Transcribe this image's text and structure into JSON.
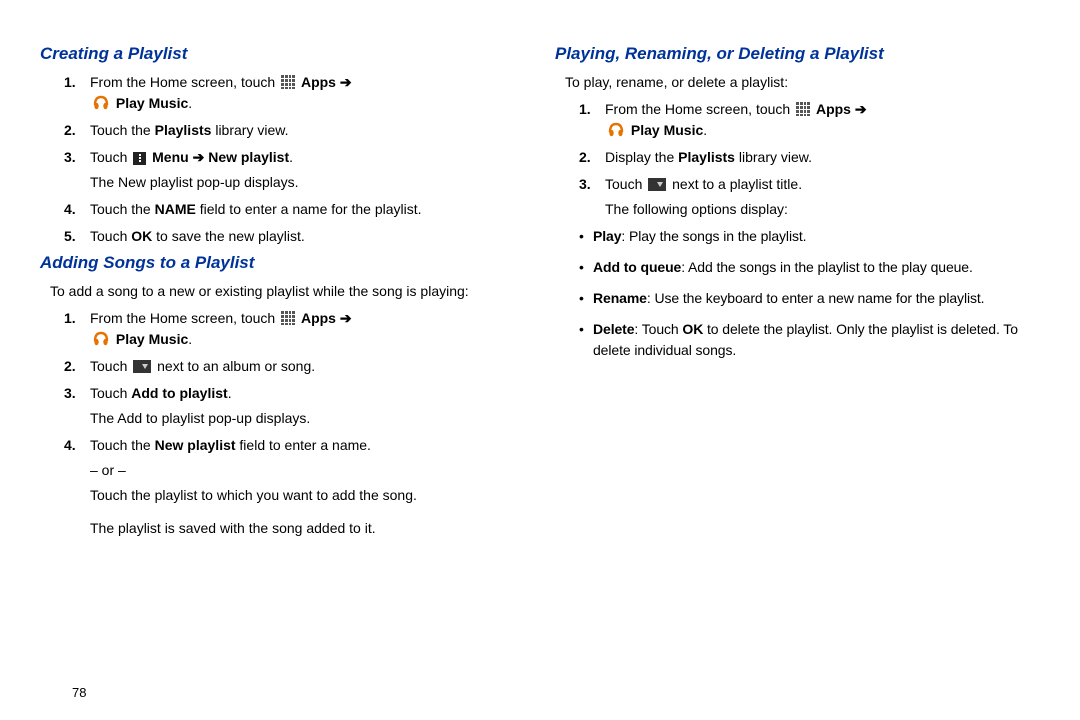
{
  "pageNumber": "78",
  "left": {
    "section1": {
      "heading": "Creating a Playlist",
      "steps": [
        {
          "num": "1.",
          "pre": "From the Home screen, touch ",
          "apps": "Apps",
          "arrow": " ➔",
          "pm": "Play Music",
          "post": "."
        },
        {
          "num": "2.",
          "text_a": "Touch the ",
          "bold_a": "Playlists",
          "text_b": " library view."
        },
        {
          "num": "3.",
          "text_a": "Touch ",
          "bold_a": "Menu ➔ New playlist",
          "text_b": ".",
          "sub": "The New playlist pop-up displays."
        },
        {
          "num": "4.",
          "text_a": "Touch the ",
          "bold_a": "NAME",
          "text_b": " field to enter a name for the playlist."
        },
        {
          "num": "5.",
          "text_a": "Touch ",
          "bold_a": "OK",
          "text_b": " to save the new playlist."
        }
      ]
    },
    "section2": {
      "heading": "Adding Songs to a Playlist",
      "intro": "To add a song to a new or existing playlist while the song is playing:",
      "steps": [
        {
          "num": "1.",
          "pre": "From the Home screen, touch ",
          "apps": "Apps",
          "arrow": " ➔",
          "pm": "Play Music",
          "post": "."
        },
        {
          "num": "2.",
          "text_a": "Touch ",
          "text_b": " next to an album or song."
        },
        {
          "num": "3.",
          "text_a": "Touch ",
          "bold_a": "Add to playlist",
          "text_b": ".",
          "sub": "The Add to playlist pop-up displays."
        },
        {
          "num": "4.",
          "text_a": "Touch the ",
          "bold_a": "New playlist",
          "text_b": " field to enter a name.",
          "sub": "– or –",
          "sub2": "Touch the playlist to which you want to add the song.",
          "sub3": "The playlist is saved with the song added to it."
        }
      ]
    }
  },
  "right": {
    "section1": {
      "heading": "Playing, Renaming, or Deleting a Playlist",
      "intro": "To play, rename, or delete a playlist:",
      "steps": [
        {
          "num": "1.",
          "pre": "From the Home screen, touch ",
          "apps": "Apps",
          "arrow": " ➔",
          "pm": "Play Music",
          "post": "."
        },
        {
          "num": "2.",
          "text_a": "Display the ",
          "bold_a": "Playlists",
          "text_b": " library view."
        },
        {
          "num": "3.",
          "text_a": "Touch ",
          "text_b": " next to a playlist title.",
          "sub": "The following options display:"
        }
      ],
      "bullets": [
        {
          "bold": "Play",
          "rest": ": Play the songs in the playlist."
        },
        {
          "bold": "Add to queue",
          "rest": ": Add the songs in the playlist to the play queue."
        },
        {
          "bold": "Rename",
          "rest": ": Use the keyboard to enter a new name for the playlist."
        },
        {
          "bold": "Delete",
          "rest_a": ": Touch ",
          "bold2": "OK",
          "rest_b": " to delete the playlist. Only the playlist is deleted. To delete individual songs."
        }
      ]
    }
  }
}
